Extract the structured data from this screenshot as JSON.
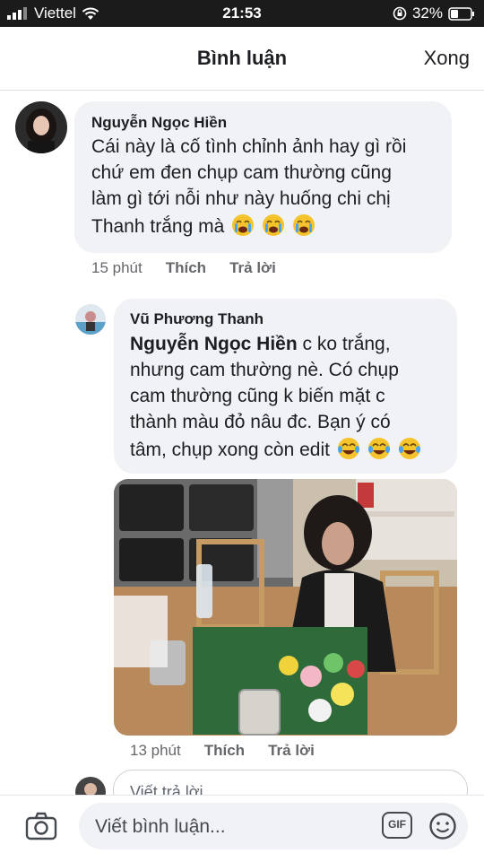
{
  "status_bar": {
    "carrier": "Viettel",
    "time": "21:53",
    "battery": "32%"
  },
  "header": {
    "title": "Bình luận",
    "done_label": "Xong"
  },
  "comments": [
    {
      "author": "Nguyễn Ngọc Hiền",
      "lines": [
        "Cái này là cố tình chỉnh ảnh hay gì rồi",
        "chứ em đen chụp cam thường cũng",
        "làm gì tới nỗi như này huống chi chị",
        "Thanh trắng mà"
      ],
      "emojis": [
        "crying-face",
        "crying-face",
        "crying-face"
      ],
      "time": "15 phút",
      "like_label": "Thích",
      "reply_label": "Trả lời"
    },
    {
      "author": "Vũ Phương Thanh",
      "mention": "Nguyễn Ngọc Hiền",
      "lines": [
        " c ko trắng,",
        "nhưng cam thường nè. Có chụp",
        "cam thường cũng k biến mặt c",
        "thành màu đỏ nâu đc. Bạn ý có",
        "tâm, chụp xong còn edit"
      ],
      "emojis": [
        "tears-of-joy",
        "tears-of-joy",
        "tears-of-joy"
      ],
      "time": "13 phút",
      "like_label": "Thích",
      "reply_label": "Trả lời"
    }
  ],
  "reply_input": {
    "placeholder": "Viết trả lời..."
  },
  "composer": {
    "placeholder": "Viết bình luận...",
    "gif_label": "GIF"
  }
}
